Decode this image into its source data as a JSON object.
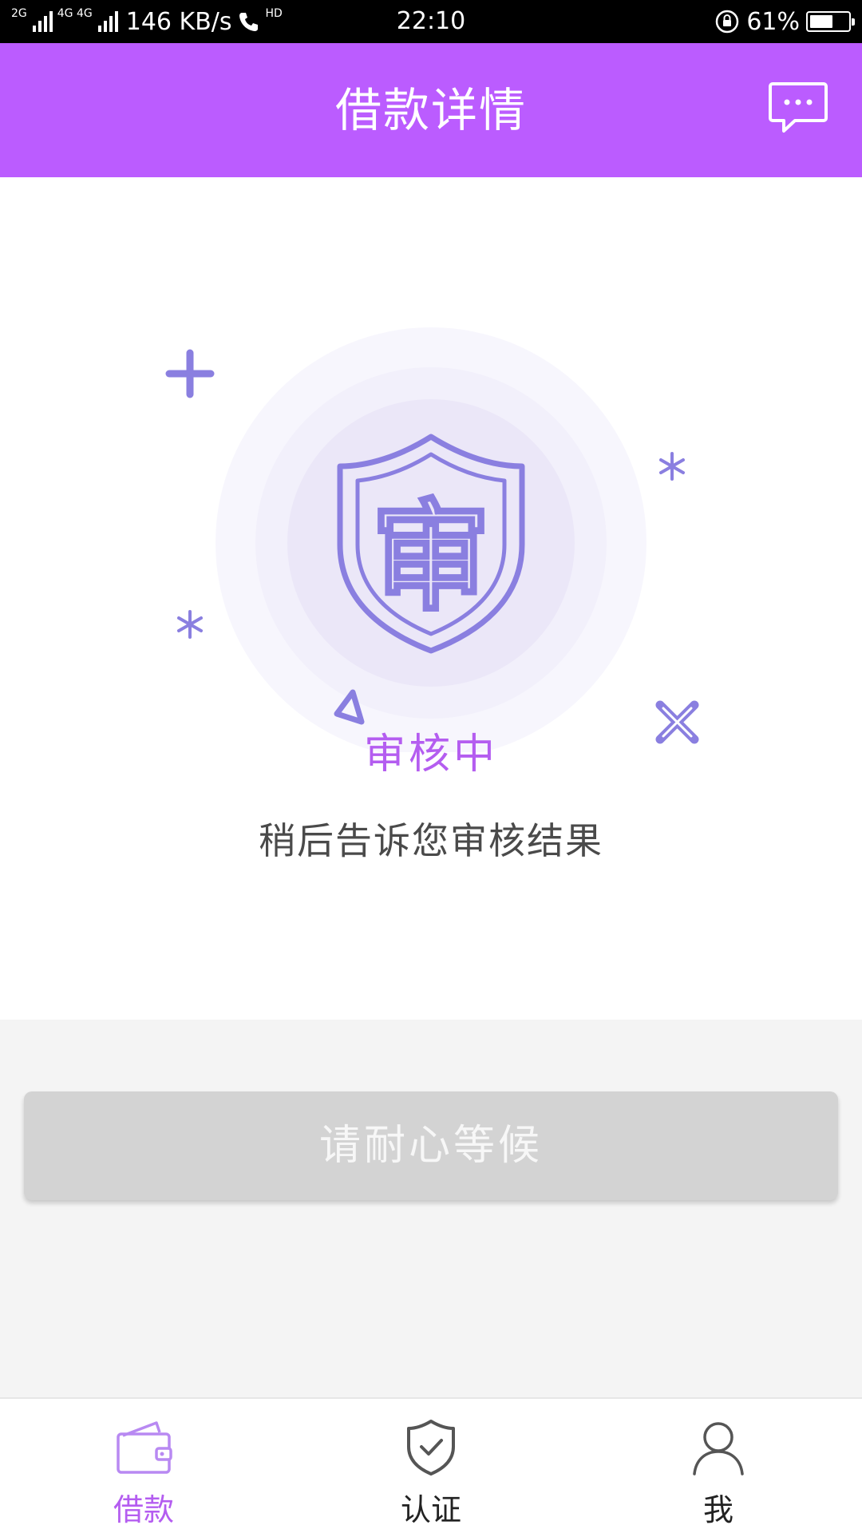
{
  "status_bar": {
    "network_1": "2G",
    "network_2": "4G 4G",
    "speed": "146 KB/s",
    "hd": "HD",
    "time": "22:10",
    "battery": "61%",
    "battery_level": 0.61
  },
  "header": {
    "title": "借款详情",
    "message_icon": "chat-bubble-icon"
  },
  "main": {
    "status_title": "审核中",
    "status_desc": "稍后告诉您审核结果",
    "shield_char": "审"
  },
  "action": {
    "wait_label": "请耐心等候"
  },
  "nav": {
    "items": [
      {
        "label": "借款",
        "icon": "wallet-icon",
        "active": true
      },
      {
        "label": "认证",
        "icon": "shield-check-icon",
        "active": false
      },
      {
        "label": "我",
        "icon": "user-icon",
        "active": false
      }
    ]
  },
  "colors": {
    "brand": "#bb5cff",
    "accent_text": "#b45df0",
    "illustration": "#8a7fe0",
    "button_disabled": "#d3d3d3"
  }
}
